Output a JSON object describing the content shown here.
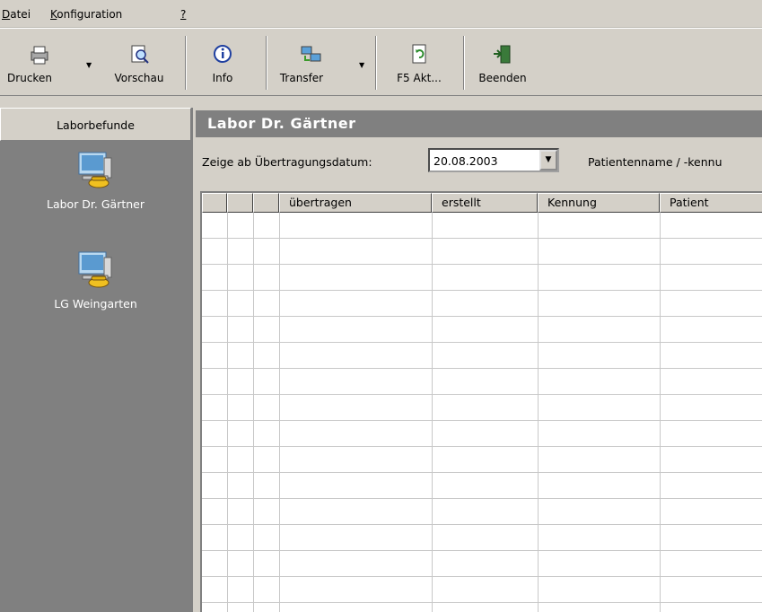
{
  "menu": {
    "items": [
      {
        "accel": "D",
        "rest": "atei"
      },
      {
        "accel": "K",
        "rest": "onfiguration"
      },
      {
        "accel": "?",
        "rest": ""
      }
    ]
  },
  "toolbar": {
    "print_label": "Drucken",
    "preview_label": "Vorschau",
    "info_label": "Info",
    "transfer_label": "Transfer",
    "refresh_label": "F5 Akt...",
    "exit_label": "Beenden"
  },
  "sidebar": {
    "header": "Laborbefunde",
    "items": [
      {
        "label": "Labor Dr. Gärtner",
        "icon": "lab-computer-phone-icon"
      },
      {
        "label": "LG Weingarten",
        "icon": "lab-computer-phone-icon"
      }
    ]
  },
  "main": {
    "title": "Labor Dr. Gärtner",
    "filter_label": "Zeige ab Übertragungsdatum:",
    "date_value": "20.08.2003",
    "patient_label": "Patientenname / -kennu"
  },
  "grid": {
    "columns": [
      "",
      "",
      "",
      "übertragen",
      "erstellt",
      "Kennung",
      "Patient"
    ],
    "rows": []
  },
  "colors": {
    "face": "#d4d0c8",
    "sidebar_bg": "#808080",
    "title_bg": "#808080"
  }
}
